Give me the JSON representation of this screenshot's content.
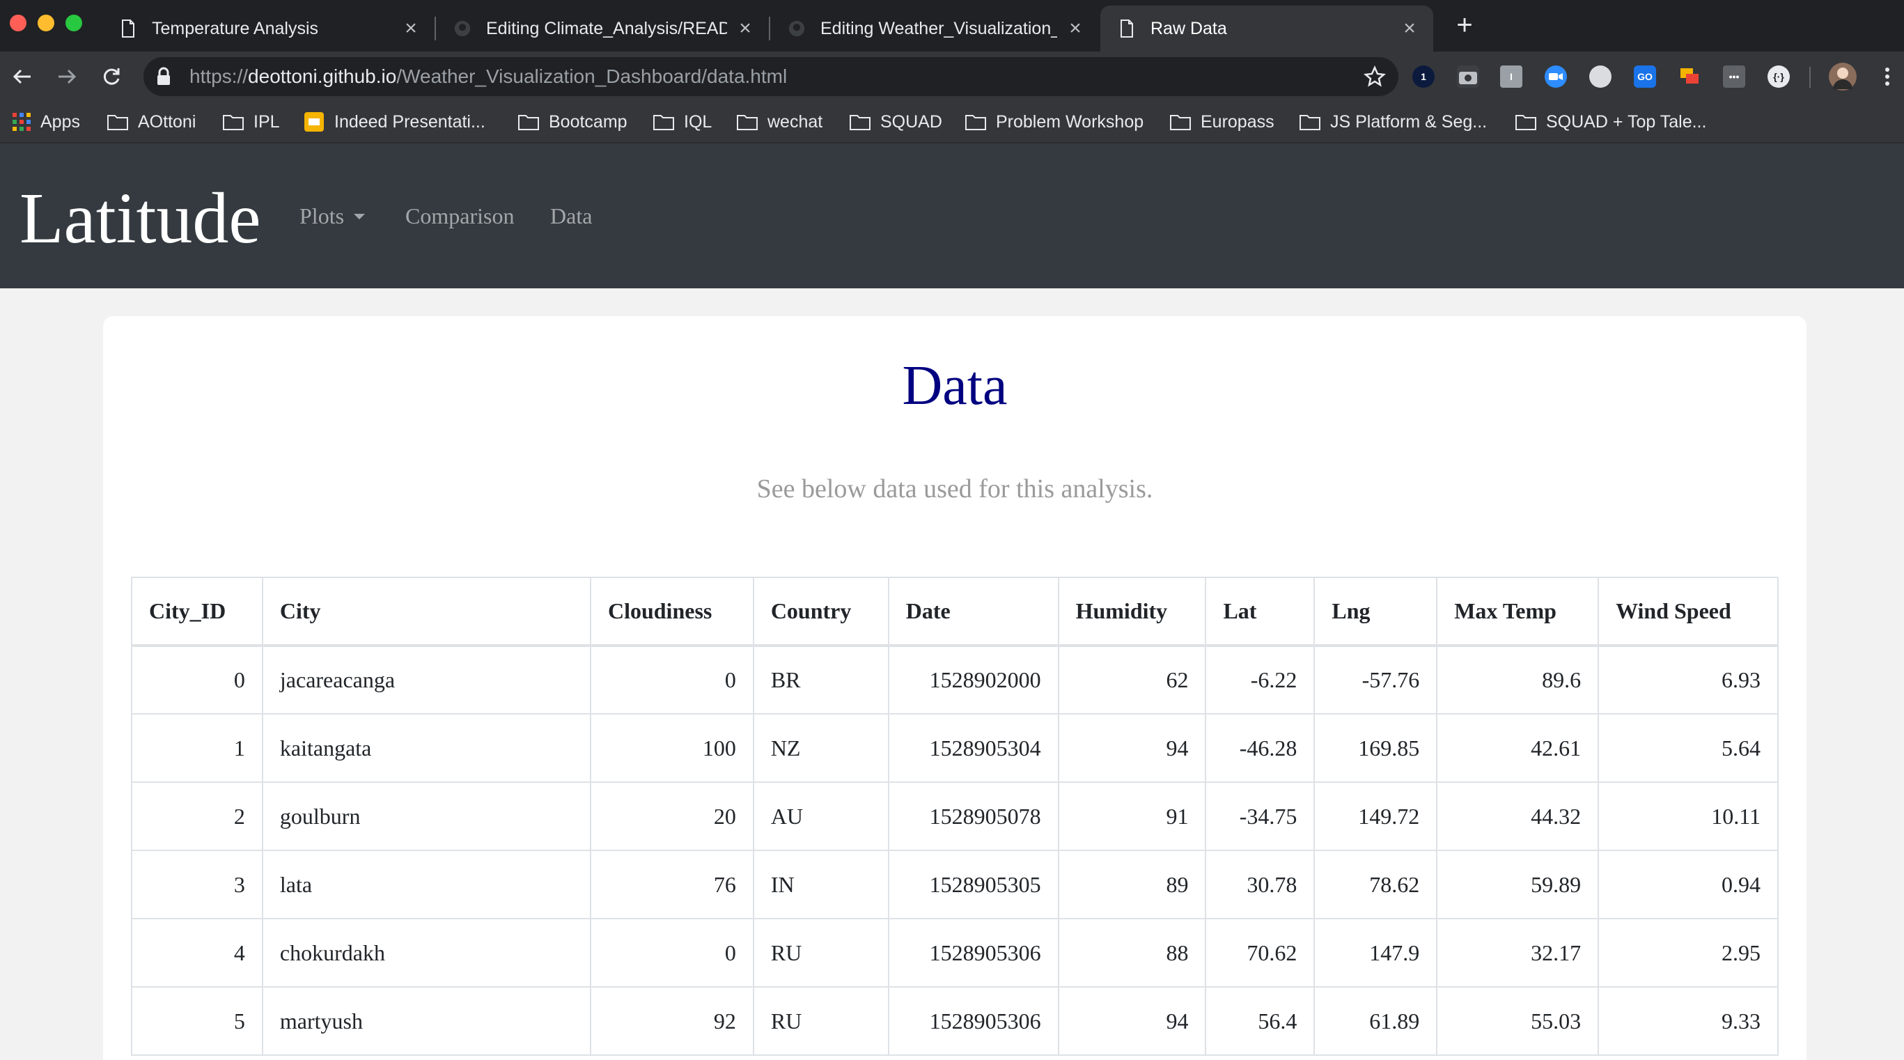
{
  "browser": {
    "tabs": [
      {
        "title": "Temperature Analysis",
        "icon": "page-icon",
        "active": false
      },
      {
        "title": "Editing Climate_Analysis/READ",
        "icon": "github-icon",
        "active": false
      },
      {
        "title": "Editing Weather_Visualization_",
        "icon": "github-icon",
        "active": false
      },
      {
        "title": "Raw Data",
        "icon": "page-icon",
        "active": true
      }
    ],
    "url": {
      "scheme": "https://",
      "host": "deottoni.github.io",
      "path": "/Weather_Visualization_Dashboard/data.html"
    },
    "extensions": [
      "1password-icon",
      "camera-icon",
      "ext-i-icon",
      "zoom-icon",
      "ext-circle-icon",
      "go-icon",
      "slides-ext-icon",
      "dots-ext-icon",
      "bracket-ext-icon"
    ],
    "bookmarks": [
      {
        "label": "Apps",
        "icon": "apps-grid-icon"
      },
      {
        "label": "AOttoni",
        "icon": "folder-icon"
      },
      {
        "label": "IPL",
        "icon": "folder-icon"
      },
      {
        "label": "Indeed Presentati...",
        "icon": "slides-icon"
      },
      {
        "label": "Bootcamp",
        "icon": "folder-icon"
      },
      {
        "label": "IQL",
        "icon": "folder-icon"
      },
      {
        "label": "wechat",
        "icon": "folder-icon"
      },
      {
        "label": "SQUAD",
        "icon": "folder-icon"
      },
      {
        "label": "Problem Workshop",
        "icon": "folder-icon"
      },
      {
        "label": "Europass",
        "icon": "folder-icon"
      },
      {
        "label": "JS Platform & Seg...",
        "icon": "folder-icon"
      },
      {
        "label": "SQUAD + Top Tale...",
        "icon": "folder-icon"
      }
    ],
    "colors": {
      "tabbar": "#202124",
      "toolbar": "#35363a",
      "close_red": "#ff5f57",
      "min_yellow": "#febc2e",
      "max_green": "#28c840"
    }
  },
  "navbar": {
    "brand": "Latitude",
    "links": {
      "plots": "Plots",
      "comparison": "Comparison",
      "data": "Data"
    },
    "background": "#343a40"
  },
  "main": {
    "title": "Data",
    "subtitle": "See below data used for this analysis.",
    "title_color": "#000080"
  },
  "table": {
    "columns": [
      "City_ID",
      "City",
      "Cloudiness",
      "Country",
      "Date",
      "Humidity",
      "Lat",
      "Lng",
      "Max Temp",
      "Wind Speed"
    ],
    "rows": [
      [
        "0",
        "jacareacanga",
        "0",
        "BR",
        "1528902000",
        "62",
        "-6.22",
        "-57.76",
        "89.6",
        "6.93"
      ],
      [
        "1",
        "kaitangata",
        "100",
        "NZ",
        "1528905304",
        "94",
        "-46.28",
        "169.85",
        "42.61",
        "5.64"
      ],
      [
        "2",
        "goulburn",
        "20",
        "AU",
        "1528905078",
        "91",
        "-34.75",
        "149.72",
        "44.32",
        "10.11"
      ],
      [
        "3",
        "lata",
        "76",
        "IN",
        "1528905305",
        "89",
        "30.78",
        "78.62",
        "59.89",
        "0.94"
      ],
      [
        "4",
        "chokurdakh",
        "0",
        "RU",
        "1528905306",
        "88",
        "70.62",
        "147.9",
        "32.17",
        "2.95"
      ],
      [
        "5",
        "martyush",
        "92",
        "RU",
        "1528905306",
        "94",
        "56.4",
        "61.89",
        "55.03",
        "9.33"
      ]
    ]
  }
}
